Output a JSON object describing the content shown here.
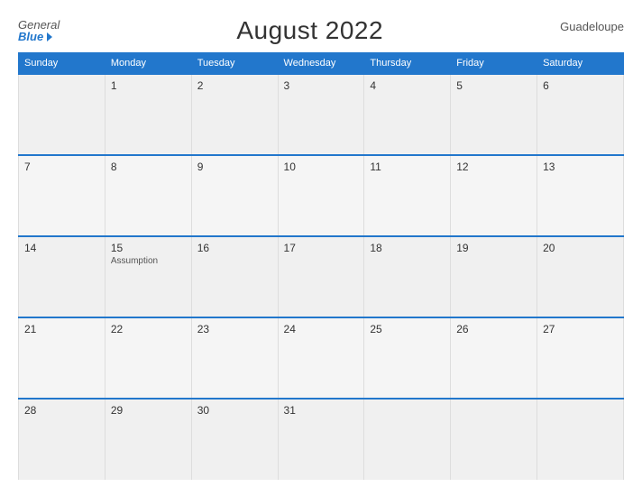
{
  "header": {
    "logo_general": "General",
    "logo_blue": "Blue",
    "title": "August 2022",
    "region": "Guadeloupe"
  },
  "days_header": [
    "Sunday",
    "Monday",
    "Tuesday",
    "Wednesday",
    "Thursday",
    "Friday",
    "Saturday"
  ],
  "weeks": [
    [
      {
        "day": "",
        "holiday": ""
      },
      {
        "day": "1",
        "holiday": ""
      },
      {
        "day": "2",
        "holiday": ""
      },
      {
        "day": "3",
        "holiday": ""
      },
      {
        "day": "4",
        "holiday": ""
      },
      {
        "day": "5",
        "holiday": ""
      },
      {
        "day": "6",
        "holiday": ""
      }
    ],
    [
      {
        "day": "7",
        "holiday": ""
      },
      {
        "day": "8",
        "holiday": ""
      },
      {
        "day": "9",
        "holiday": ""
      },
      {
        "day": "10",
        "holiday": ""
      },
      {
        "day": "11",
        "holiday": ""
      },
      {
        "day": "12",
        "holiday": ""
      },
      {
        "day": "13",
        "holiday": ""
      }
    ],
    [
      {
        "day": "14",
        "holiday": ""
      },
      {
        "day": "15",
        "holiday": "Assumption"
      },
      {
        "day": "16",
        "holiday": ""
      },
      {
        "day": "17",
        "holiday": ""
      },
      {
        "day": "18",
        "holiday": ""
      },
      {
        "day": "19",
        "holiday": ""
      },
      {
        "day": "20",
        "holiday": ""
      }
    ],
    [
      {
        "day": "21",
        "holiday": ""
      },
      {
        "day": "22",
        "holiday": ""
      },
      {
        "day": "23",
        "holiday": ""
      },
      {
        "day": "24",
        "holiday": ""
      },
      {
        "day": "25",
        "holiday": ""
      },
      {
        "day": "26",
        "holiday": ""
      },
      {
        "day": "27",
        "holiday": ""
      }
    ],
    [
      {
        "day": "28",
        "holiday": ""
      },
      {
        "day": "29",
        "holiday": ""
      },
      {
        "day": "30",
        "holiday": ""
      },
      {
        "day": "31",
        "holiday": ""
      },
      {
        "day": "",
        "holiday": ""
      },
      {
        "day": "",
        "holiday": ""
      },
      {
        "day": "",
        "holiday": ""
      }
    ]
  ]
}
